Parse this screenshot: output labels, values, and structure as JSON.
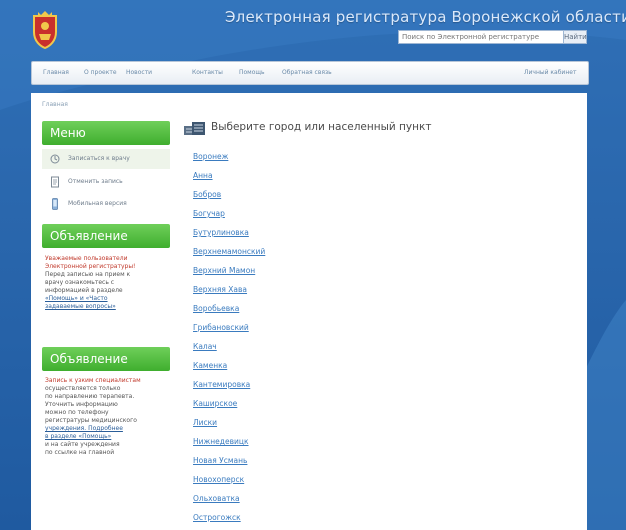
{
  "header": {
    "site_title": "Электронная регистратура Воронежской области",
    "search_placeholder": "Поиск по Электронной регистратуре",
    "search_button": "Найти"
  },
  "nav": {
    "items": [
      "Главная",
      "О проекте",
      "Новости",
      "Контакты",
      "Помощь",
      "Обратная связь"
    ],
    "right_item": "Личный кабинет"
  },
  "breadcrumb": "Главная",
  "sidebar": {
    "menu_title": "Меню",
    "menu_items": [
      "Записаться к врачу",
      "Отменить запись",
      "Мобильная версия"
    ],
    "notice1": {
      "title": "Объявление",
      "lines": [
        "Уважаемые пользователи",
        "Электронной регистратуры!",
        "Перед записью на прием к",
        "врачу ознакомьтесь с",
        "информацией в разделе",
        "«Помощь» и «Часто",
        "задаваемые вопросы»"
      ]
    },
    "notice2": {
      "title": "Объявление",
      "lines": [
        "Запись к узким специалистам",
        "осуществляется только",
        "по направлению терапевта.",
        "Уточнить информацию",
        "можно по телефону",
        "регистратуры медицинского",
        "учреждения. Подробнее",
        "в разделе «Помощь»",
        "и на сайте учреждения",
        "по ссылке на главной"
      ]
    }
  },
  "main": {
    "heading": "Выберите город или населенный пункт",
    "cities": [
      "Воронеж",
      "Анна",
      "Бобров",
      "Богучар",
      "Бутурлиновка",
      "Верхнемамонский",
      "Верхний Мамон",
      "Верхняя Хава",
      "Воробьевка",
      "Грибановский",
      "Калач",
      "Каменка",
      "Кантемировка",
      "Каширское",
      "Лиски",
      "Нижнедевицк",
      "Новая Усмань",
      "Новохоперск",
      "Ольховатка",
      "Острогожск"
    ]
  },
  "colors": {
    "background": "#2a67ad",
    "menu_green": "#3fae2e",
    "link_blue": "#3a7bbf"
  }
}
